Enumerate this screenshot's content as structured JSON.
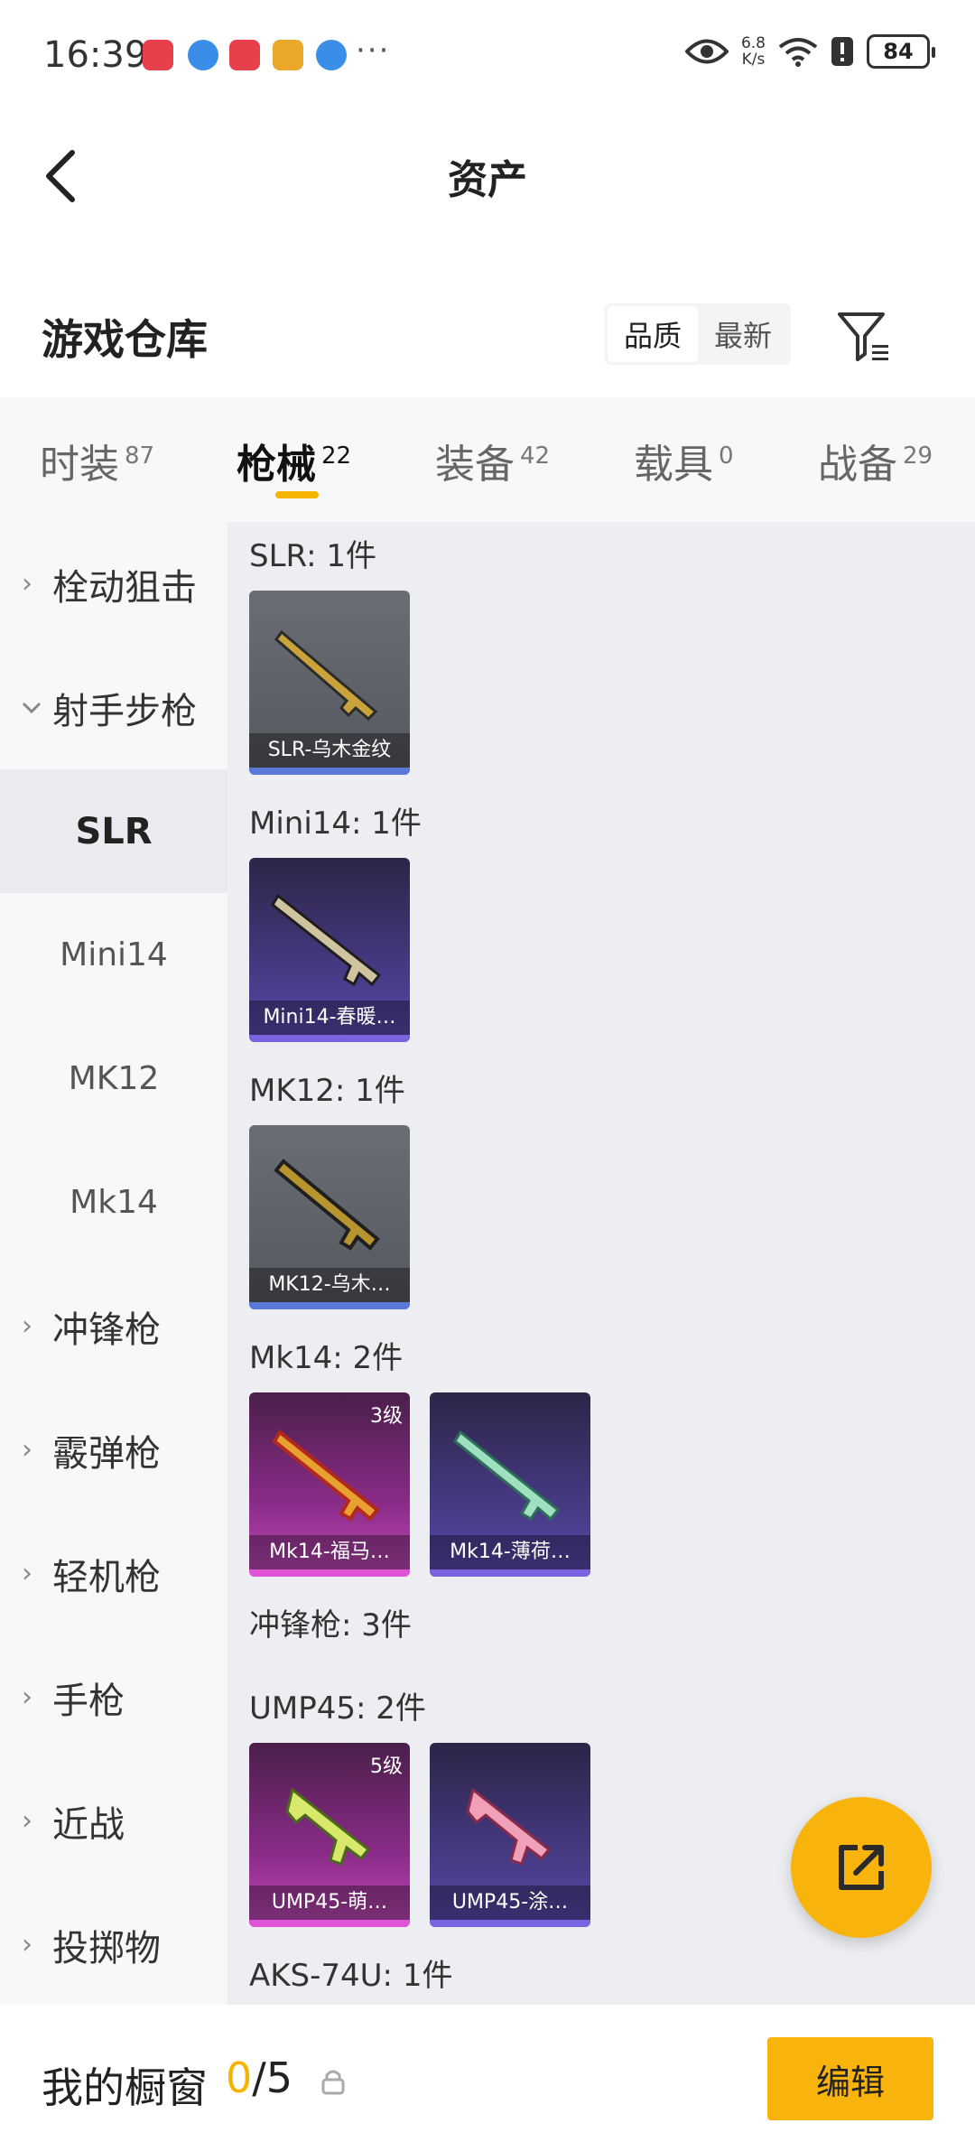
{
  "status_bar": {
    "time": "16:39",
    "net_speed_value": "6.8",
    "net_speed_unit": "K/s",
    "battery": "84",
    "more": "···"
  },
  "nav": {
    "title": "资产"
  },
  "warehouse": {
    "title": "游戏仓库",
    "sort_options": [
      "品质",
      "最新"
    ],
    "active_sort": "品质"
  },
  "tabs": [
    {
      "label": "时装",
      "count": "87"
    },
    {
      "label": "枪械",
      "count": "22",
      "active": true
    },
    {
      "label": "装备",
      "count": "42"
    },
    {
      "label": "载具",
      "count": "0"
    },
    {
      "label": "战备",
      "count": "29"
    }
  ],
  "sidebar": {
    "items": [
      {
        "label": "栓动狙击",
        "type": "category",
        "expanded": false
      },
      {
        "label": "射手步枪",
        "type": "category",
        "expanded": true
      },
      {
        "label": "SLR",
        "type": "sub",
        "active": true
      },
      {
        "label": "Mini14",
        "type": "sub"
      },
      {
        "label": "MK12",
        "type": "sub"
      },
      {
        "label": "Mk14",
        "type": "sub"
      },
      {
        "label": "冲锋枪",
        "type": "category",
        "expanded": false
      },
      {
        "label": "霰弹枪",
        "type": "category",
        "expanded": false
      },
      {
        "label": "轻机枪",
        "type": "category",
        "expanded": false
      },
      {
        "label": "手枪",
        "type": "category",
        "expanded": false
      },
      {
        "label": "近战",
        "type": "category",
        "expanded": false
      },
      {
        "label": "投掷物",
        "type": "category",
        "expanded": false
      }
    ]
  },
  "content": {
    "sections": [
      {
        "title": "SLR: 1件",
        "items": [
          {
            "name": "SLR-乌木金纹",
            "rarity": "grey"
          }
        ]
      },
      {
        "title": "Mini14: 1件",
        "items": [
          {
            "name": "Mini14-春暖…",
            "rarity": "purple"
          }
        ]
      },
      {
        "title": "MK12: 1件",
        "items": [
          {
            "name": "MK12-乌木…",
            "rarity": "grey"
          }
        ]
      },
      {
        "title": "Mk14: 2件",
        "items": [
          {
            "name": "Mk14-福马…",
            "rarity": "pink",
            "level": "3级"
          },
          {
            "name": "Mk14-薄荷…",
            "rarity": "purple"
          }
        ]
      },
      {
        "title": "冲锋枪: 3件",
        "items": []
      },
      {
        "title": "UMP45: 2件",
        "items": [
          {
            "name": "UMP45-萌…",
            "rarity": "pink",
            "level": "5级"
          },
          {
            "name": "UMP45-涂…",
            "rarity": "purple"
          }
        ]
      },
      {
        "title": "AKS-74U: 1件",
        "items": []
      }
    ]
  },
  "bottom": {
    "label": "我的橱窗",
    "current": "0",
    "separator": "/",
    "max": "5",
    "edit_label": "编辑"
  },
  "colors": {
    "accent": "#f8b40c",
    "grey_rarity": "#5a78d8",
    "purple_rarity": "#7a62e0",
    "pink_rarity": "#e054d8"
  }
}
